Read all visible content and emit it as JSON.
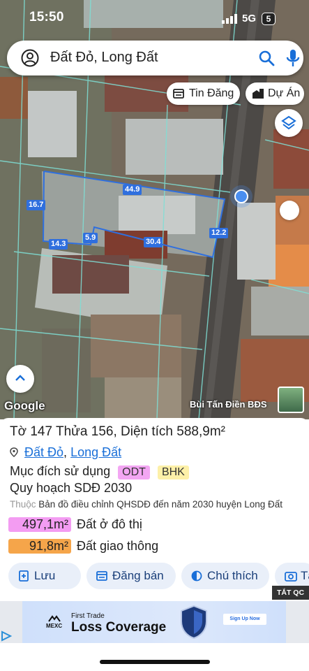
{
  "status": {
    "time": "15:50",
    "network": "5G",
    "battery": "5"
  },
  "search": {
    "query": "Đất Đỏ, Long Đất"
  },
  "chips": {
    "news": "Tin Đăng",
    "project": "Dự Án"
  },
  "dimensions": {
    "top": "44.9",
    "left": "16.7",
    "right": "12.2",
    "bottom_left": "14.3",
    "step": "5.9",
    "bottom_right": "30.4"
  },
  "attribution": {
    "logo": "Google",
    "author": "Bùi Tấn Điền BĐS"
  },
  "parcel": {
    "sheet_label": "Tờ",
    "sheet": "147",
    "plot_label": "Thửa",
    "plot": "156",
    "area_label": "Diện tích",
    "area": "588,9m²",
    "district": "Đất Đỏ",
    "province": "Long Đất",
    "purpose_label": "Mục đích sử dụng",
    "purpose_codes": [
      "ODT",
      "BHK"
    ],
    "planning": "Quy hoạch SDĐ 2030",
    "belongs_prefix": "Thuộc",
    "belongs": "Bản đồ điều chỉnh QHSDĐ đến năm 2030 huyện Long Đất"
  },
  "areas": [
    {
      "value": "497,1m²",
      "label": "Đất ở đô thị",
      "color": "#f39cf2"
    },
    {
      "value": "91,8m²",
      "label": "Đất giao thông",
      "color": "#f5a54a"
    }
  ],
  "actions": {
    "save": "Lưu",
    "sell": "Đăng bán",
    "note": "Chú thích",
    "more": "Tạo"
  },
  "ad_close": "TẮT QC",
  "ad": {
    "brand": "MEXC",
    "sub": "First Trade",
    "main": "Loss Coverage",
    "cta": "Sign Up Now"
  }
}
